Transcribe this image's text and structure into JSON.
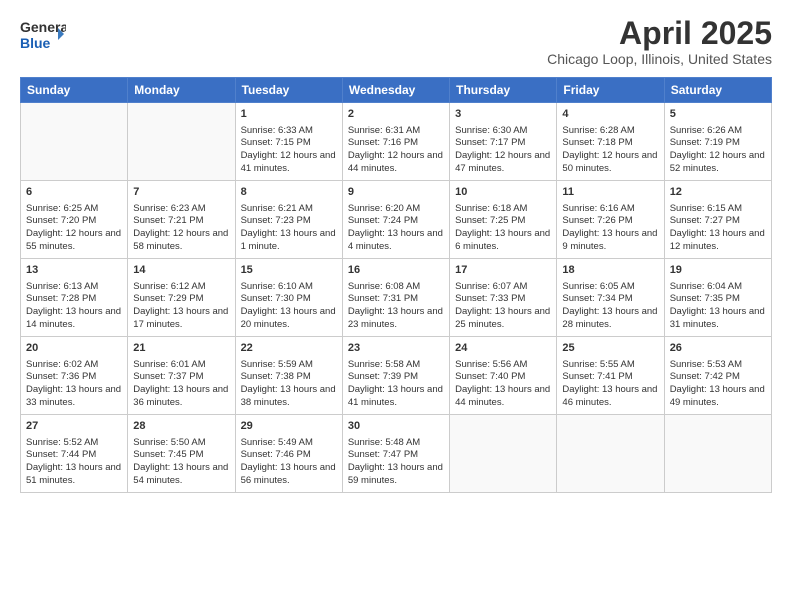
{
  "header": {
    "logo_general": "General",
    "logo_blue": "Blue",
    "month": "April 2025",
    "location": "Chicago Loop, Illinois, United States"
  },
  "weekdays": [
    "Sunday",
    "Monday",
    "Tuesday",
    "Wednesday",
    "Thursday",
    "Friday",
    "Saturday"
  ],
  "weeks": [
    [
      {
        "day": "",
        "info": ""
      },
      {
        "day": "",
        "info": ""
      },
      {
        "day": "1",
        "info": "Sunrise: 6:33 AM\nSunset: 7:15 PM\nDaylight: 12 hours and 41 minutes."
      },
      {
        "day": "2",
        "info": "Sunrise: 6:31 AM\nSunset: 7:16 PM\nDaylight: 12 hours and 44 minutes."
      },
      {
        "day": "3",
        "info": "Sunrise: 6:30 AM\nSunset: 7:17 PM\nDaylight: 12 hours and 47 minutes."
      },
      {
        "day": "4",
        "info": "Sunrise: 6:28 AM\nSunset: 7:18 PM\nDaylight: 12 hours and 50 minutes."
      },
      {
        "day": "5",
        "info": "Sunrise: 6:26 AM\nSunset: 7:19 PM\nDaylight: 12 hours and 52 minutes."
      }
    ],
    [
      {
        "day": "6",
        "info": "Sunrise: 6:25 AM\nSunset: 7:20 PM\nDaylight: 12 hours and 55 minutes."
      },
      {
        "day": "7",
        "info": "Sunrise: 6:23 AM\nSunset: 7:21 PM\nDaylight: 12 hours and 58 minutes."
      },
      {
        "day": "8",
        "info": "Sunrise: 6:21 AM\nSunset: 7:23 PM\nDaylight: 13 hours and 1 minute."
      },
      {
        "day": "9",
        "info": "Sunrise: 6:20 AM\nSunset: 7:24 PM\nDaylight: 13 hours and 4 minutes."
      },
      {
        "day": "10",
        "info": "Sunrise: 6:18 AM\nSunset: 7:25 PM\nDaylight: 13 hours and 6 minutes."
      },
      {
        "day": "11",
        "info": "Sunrise: 6:16 AM\nSunset: 7:26 PM\nDaylight: 13 hours and 9 minutes."
      },
      {
        "day": "12",
        "info": "Sunrise: 6:15 AM\nSunset: 7:27 PM\nDaylight: 13 hours and 12 minutes."
      }
    ],
    [
      {
        "day": "13",
        "info": "Sunrise: 6:13 AM\nSunset: 7:28 PM\nDaylight: 13 hours and 14 minutes."
      },
      {
        "day": "14",
        "info": "Sunrise: 6:12 AM\nSunset: 7:29 PM\nDaylight: 13 hours and 17 minutes."
      },
      {
        "day": "15",
        "info": "Sunrise: 6:10 AM\nSunset: 7:30 PM\nDaylight: 13 hours and 20 minutes."
      },
      {
        "day": "16",
        "info": "Sunrise: 6:08 AM\nSunset: 7:31 PM\nDaylight: 13 hours and 23 minutes."
      },
      {
        "day": "17",
        "info": "Sunrise: 6:07 AM\nSunset: 7:33 PM\nDaylight: 13 hours and 25 minutes."
      },
      {
        "day": "18",
        "info": "Sunrise: 6:05 AM\nSunset: 7:34 PM\nDaylight: 13 hours and 28 minutes."
      },
      {
        "day": "19",
        "info": "Sunrise: 6:04 AM\nSunset: 7:35 PM\nDaylight: 13 hours and 31 minutes."
      }
    ],
    [
      {
        "day": "20",
        "info": "Sunrise: 6:02 AM\nSunset: 7:36 PM\nDaylight: 13 hours and 33 minutes."
      },
      {
        "day": "21",
        "info": "Sunrise: 6:01 AM\nSunset: 7:37 PM\nDaylight: 13 hours and 36 minutes."
      },
      {
        "day": "22",
        "info": "Sunrise: 5:59 AM\nSunset: 7:38 PM\nDaylight: 13 hours and 38 minutes."
      },
      {
        "day": "23",
        "info": "Sunrise: 5:58 AM\nSunset: 7:39 PM\nDaylight: 13 hours and 41 minutes."
      },
      {
        "day": "24",
        "info": "Sunrise: 5:56 AM\nSunset: 7:40 PM\nDaylight: 13 hours and 44 minutes."
      },
      {
        "day": "25",
        "info": "Sunrise: 5:55 AM\nSunset: 7:41 PM\nDaylight: 13 hours and 46 minutes."
      },
      {
        "day": "26",
        "info": "Sunrise: 5:53 AM\nSunset: 7:42 PM\nDaylight: 13 hours and 49 minutes."
      }
    ],
    [
      {
        "day": "27",
        "info": "Sunrise: 5:52 AM\nSunset: 7:44 PM\nDaylight: 13 hours and 51 minutes."
      },
      {
        "day": "28",
        "info": "Sunrise: 5:50 AM\nSunset: 7:45 PM\nDaylight: 13 hours and 54 minutes."
      },
      {
        "day": "29",
        "info": "Sunrise: 5:49 AM\nSunset: 7:46 PM\nDaylight: 13 hours and 56 minutes."
      },
      {
        "day": "30",
        "info": "Sunrise: 5:48 AM\nSunset: 7:47 PM\nDaylight: 13 hours and 59 minutes."
      },
      {
        "day": "",
        "info": ""
      },
      {
        "day": "",
        "info": ""
      },
      {
        "day": "",
        "info": ""
      }
    ]
  ]
}
